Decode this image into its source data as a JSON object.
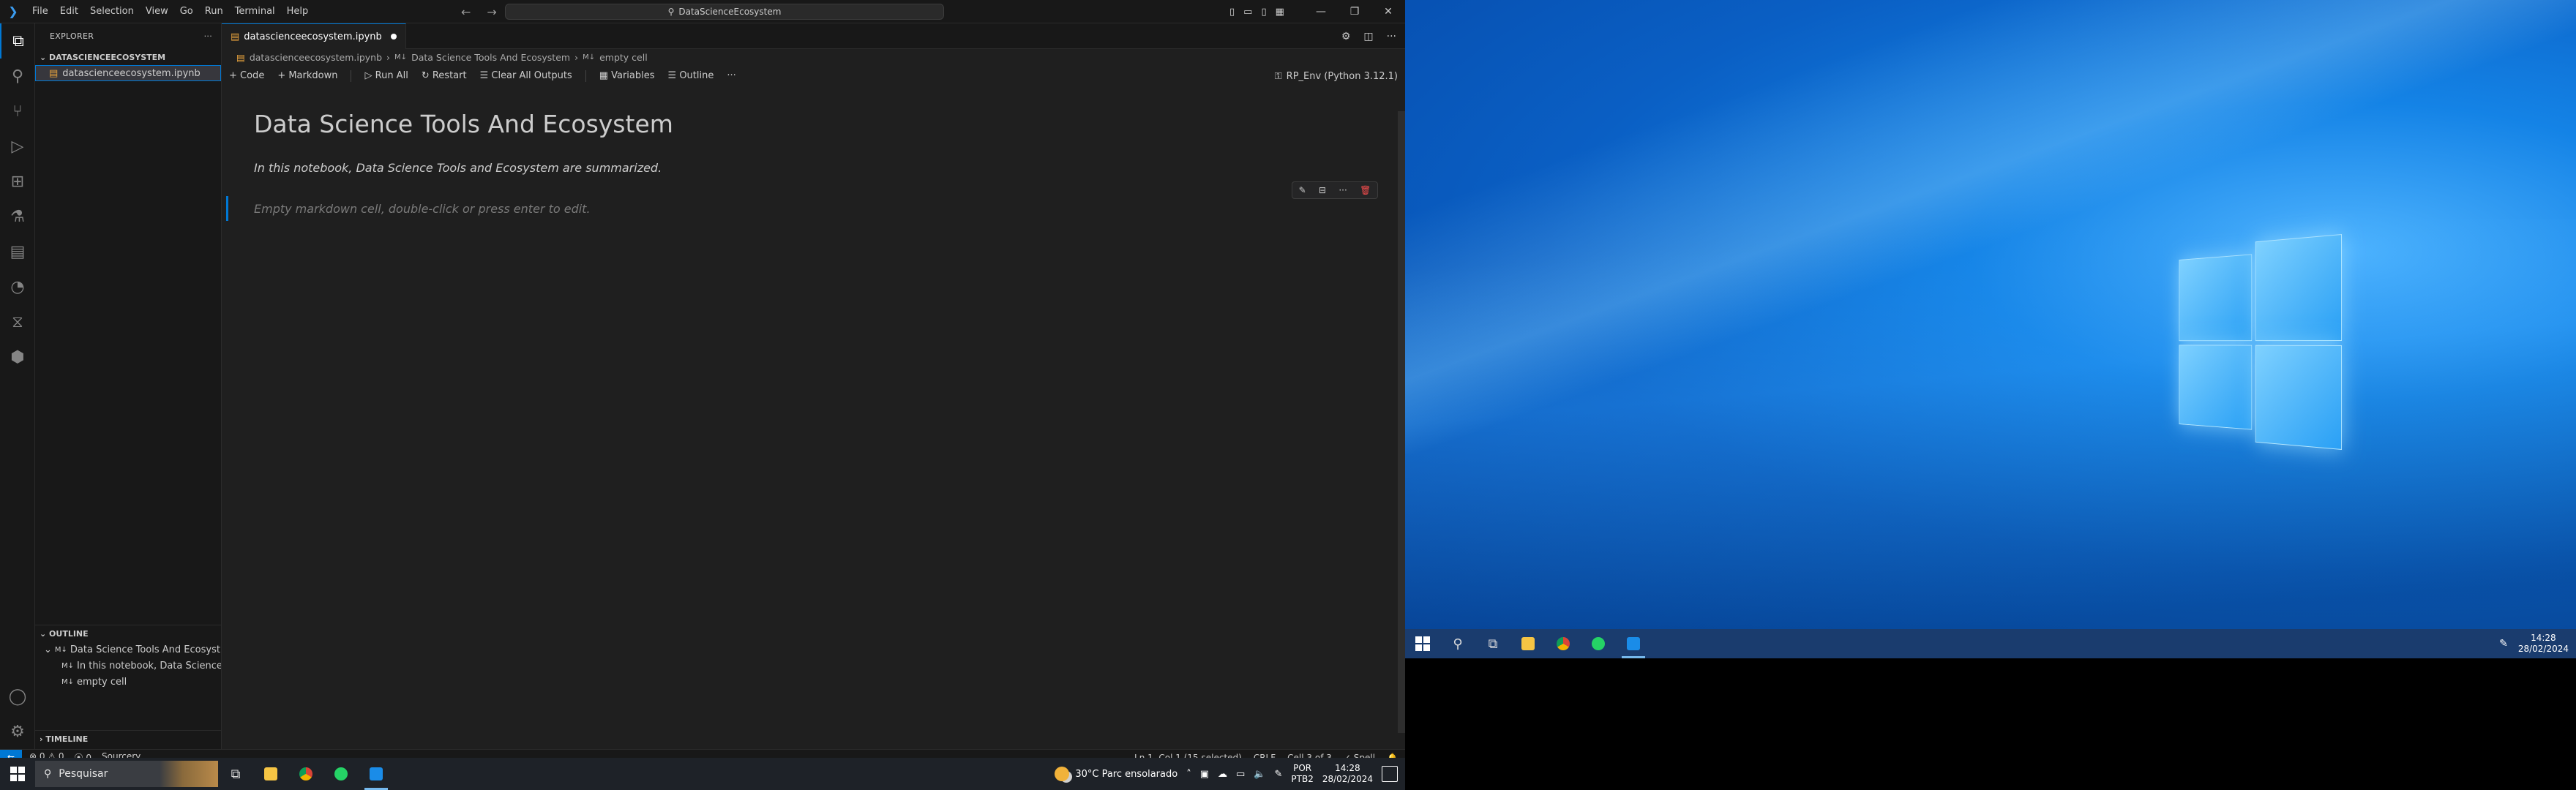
{
  "titlebar": {
    "menu": [
      "File",
      "Edit",
      "Selection",
      "View",
      "Go",
      "Run",
      "Terminal",
      "Help"
    ],
    "search_text": "DataScienceEcosystem"
  },
  "sidebar": {
    "title": "EXPLORER",
    "folder": "DATASCIENCEECOSYSTEM",
    "file": "datascienceecosystem.ipynb",
    "outline_title": "OUTLINE",
    "outline_items": [
      "Data Science Tools And Ecosyst...",
      "In this notebook, Data Science...",
      "empty cell"
    ],
    "timeline_title": "TIMELINE"
  },
  "editor": {
    "tab_label": "datascienceecosystem.ipynb",
    "breadcrumb": {
      "file": "datascienceecosystem.ipynb",
      "heading": "Data Science Tools And Ecosystem",
      "cell": "empty cell"
    },
    "toolbar": {
      "code": "Code",
      "markdown": "Markdown",
      "run_all": "Run All",
      "restart": "Restart",
      "clear": "Clear All Outputs",
      "variables": "Variables",
      "outline": "Outline",
      "kernel": "RP_Env (Python 3.12.1)"
    },
    "cells": {
      "heading": "Data Science Tools And Ecosystem",
      "paragraph": "In this notebook, Data Science Tools and Ecosystem are summarized.",
      "empty": "Empty markdown cell, double-click or press enter to edit."
    }
  },
  "statusbar": {
    "errors": "0",
    "warnings": "0",
    "ports": "0",
    "sourcery": "Sourcery",
    "position": "Ln 1, Col 1 (15 selected)",
    "eol": "CRLF",
    "cell": "Cell 3 of 3",
    "spell": "Spell"
  },
  "taskbar1": {
    "search_placeholder": "Pesquisar",
    "weather": "30°C  Parc ensolarado",
    "lang1": "POR",
    "lang2": "PTB2",
    "time": "14:28",
    "date": "28/02/2024"
  },
  "taskbar2": {
    "time": "14:28",
    "date": "28/02/2024"
  },
  "colors": {
    "accent": "#0078d4",
    "desktop": "#1483e6"
  }
}
